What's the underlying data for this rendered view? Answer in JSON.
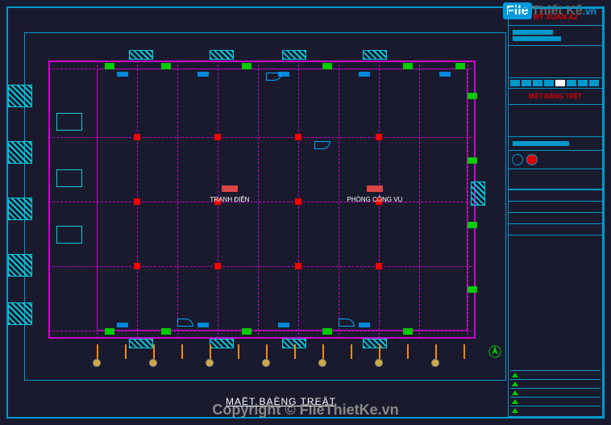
{
  "watermark": {
    "logo_file": "File",
    "logo_thiet": "Thiết Kế",
    "logo_vn": ".vn",
    "copyright": "Copyright © FileThietKe.vn"
  },
  "drawing": {
    "title": "MAËT BAÈNG TREÄT",
    "rooms": [
      {
        "label": "TRANH ĐIỆN"
      },
      {
        "label": "PHÒNG CÔNG VỤ"
      }
    ]
  },
  "titleblock": {
    "project": "MỸ XUÂN A2",
    "sheet_title": "MẶT BẰNG TRỆT",
    "grid_labels": [
      "",
      "",
      "",
      "",
      "",
      "",
      "",
      ""
    ],
    "table_rows": [
      "",
      "",
      "",
      ""
    ],
    "legend_rows": [
      "",
      "",
      "",
      "",
      ""
    ]
  },
  "grid": {
    "v_positions": [
      60,
      110,
      160,
      210,
      260,
      310,
      360,
      410,
      460,
      510
    ],
    "h_positions": [
      10,
      95,
      175,
      255,
      335
    ],
    "tick_positions": [
      60,
      95,
      130,
      165,
      200,
      235,
      270,
      305,
      340,
      375,
      410,
      445,
      480,
      515
    ]
  }
}
